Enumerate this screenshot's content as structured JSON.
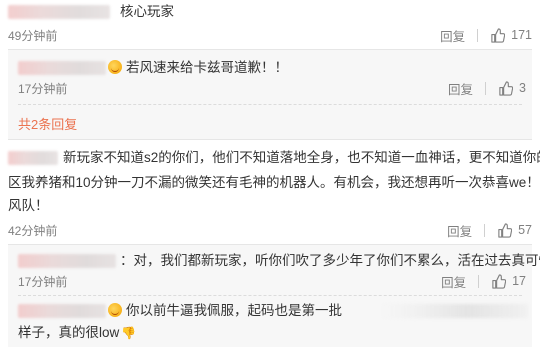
{
  "comments": [
    {
      "text": "核心玩家",
      "time": "49分钟前",
      "reply_label": "回复",
      "likes": "171",
      "replies": [
        {
          "text": "若风速来给卡兹哥道歉！！",
          "time": "17分钟前",
          "reply_label": "回复",
          "likes": "3"
        }
      ],
      "more_replies": "共2条回复"
    },
    {
      "text_line1": "新玩家不知道s2的你们，他们不知道落地全身，也不知道一血神话，更不知道你的野",
      "text_line2": "区我养猪和10分钟一刀不漏的微笑还有毛神的机器人。有机会，我还想再听一次恭喜we！加油",
      "text_line3": "风队！",
      "time": "42分钟前",
      "reply_label": "回复",
      "likes": "57",
      "replies": [
        {
          "text": "：对，我们都新玩家，听你们吹了多少年了你们不累么，活在过去真可怜",
          "time": "17分钟前",
          "reply_label": "回复",
          "likes": "17"
        },
        {
          "text_line1": "你以前牛逼我佩服，起码也是第一批",
          "text_line2": "样子，真的很low"
        }
      ]
    }
  ]
}
